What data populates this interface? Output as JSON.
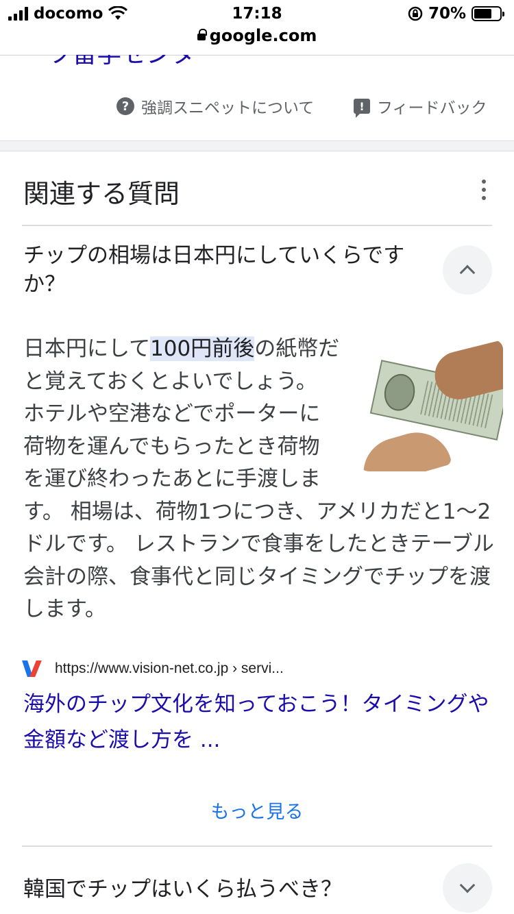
{
  "status_bar": {
    "carrier": "docomo",
    "time": "17:18",
    "battery": "70%",
    "battery_level": 0.7,
    "url": "google.com"
  },
  "prev_card": {
    "title_fragment": "ーツ留学センター",
    "snippet_about": "強調スニペットについて",
    "feedback": "フィードバック"
  },
  "related": {
    "title": "関連する質問",
    "q1": {
      "question": "チップの相場は日本円にしていくらですか？",
      "answer_pre": "日本円にして",
      "answer_highlight": "100円前後",
      "answer_post": "の紙幣だと覚えておくとよいでしょう。 ホテルや空港などでポーターに荷物を運んでもらったとき荷物を運び終わったあとに手渡します。 相場は、荷物1つにつき、アメリカだと1〜2ドルです。 レストランで食事をしたときテーブル会計の際、食事代と同じタイミングでチップを渡します。",
      "source_url": "https://www.vision-net.co.jp › servi...",
      "link_title": "海外のチップ文化を知っておこう！タイミングや金額など渡し方を ..."
    },
    "more": "もっと見る",
    "q2": {
      "question": "韓国でチップはいくら払うべき？"
    }
  }
}
